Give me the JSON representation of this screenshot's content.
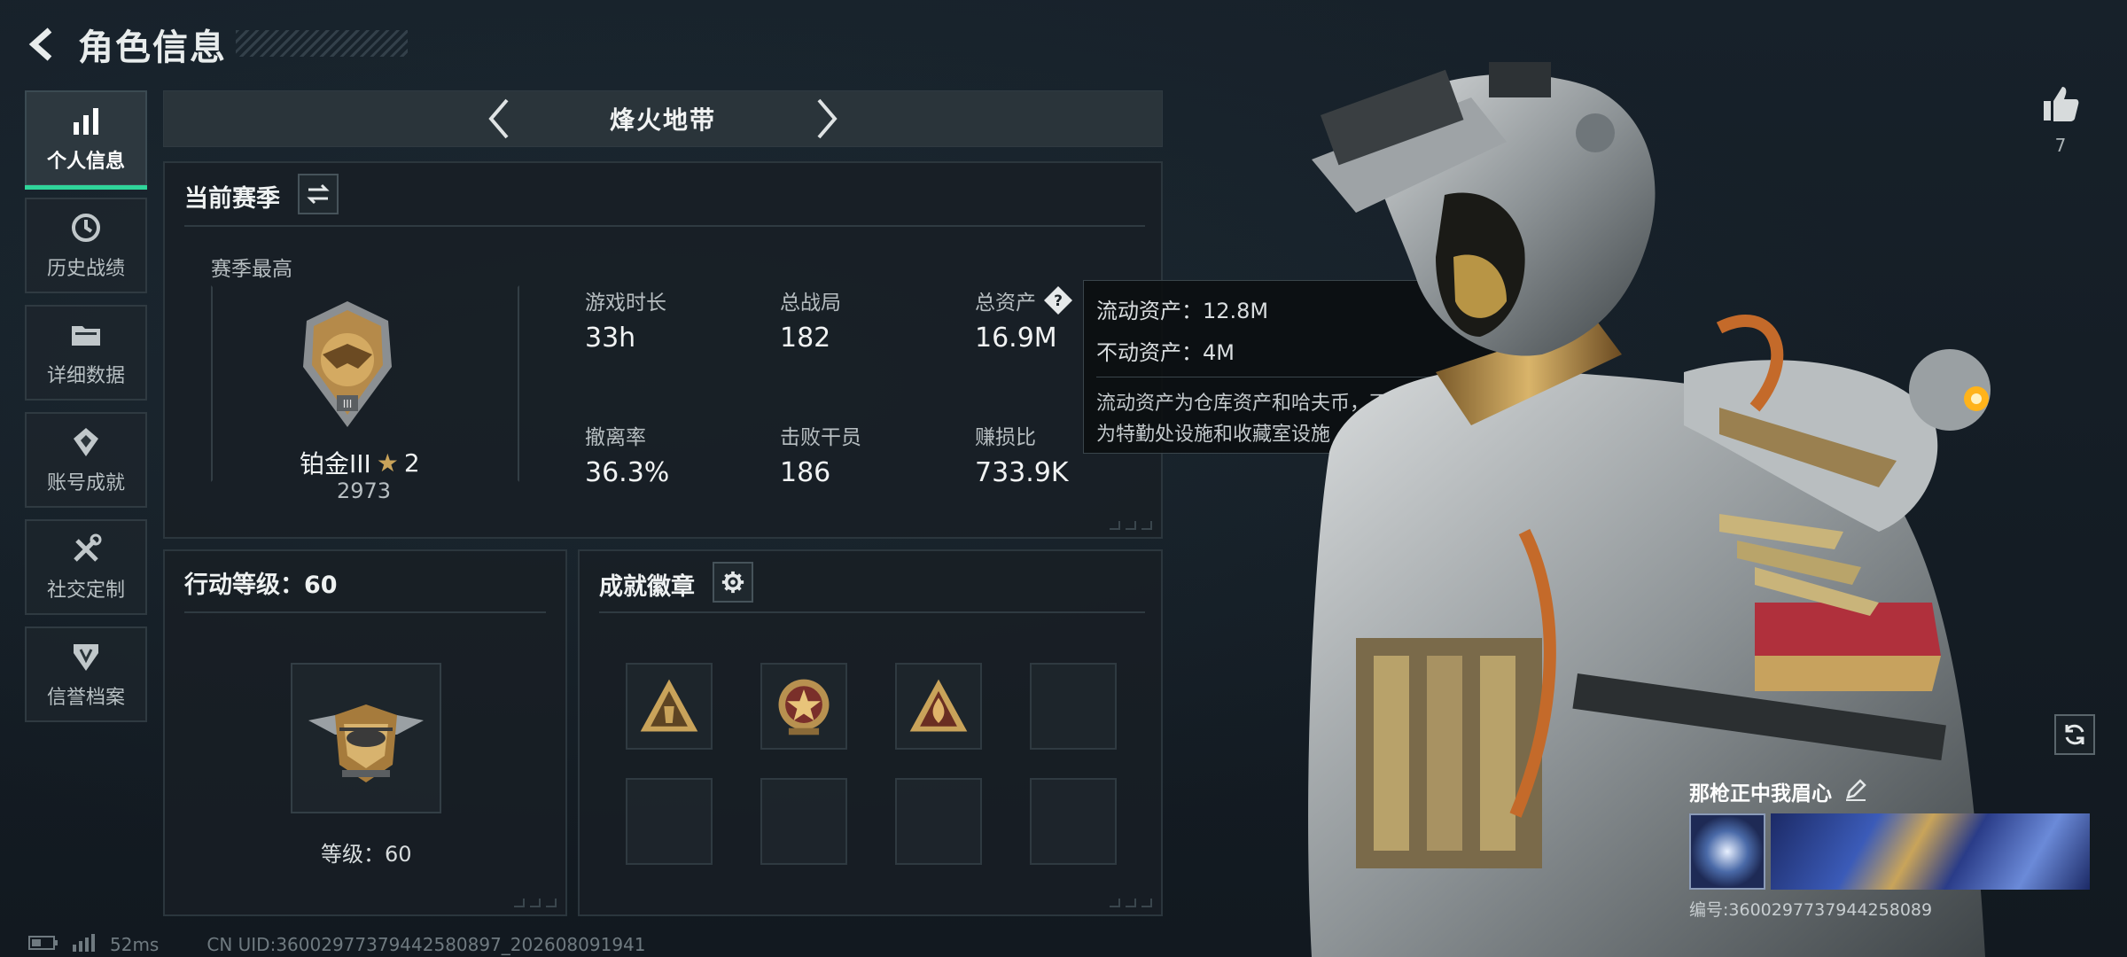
{
  "header": {
    "title": "角色信息"
  },
  "nav": {
    "items": [
      {
        "label": "个人信息",
        "icon": "bar-chart-icon",
        "active": true
      },
      {
        "label": "历史战绩",
        "icon": "history-clock-icon",
        "active": false
      },
      {
        "label": "详细数据",
        "icon": "folder-icon",
        "active": false
      },
      {
        "label": "账号成就",
        "icon": "achievement-icon",
        "active": false
      },
      {
        "label": "社交定制",
        "icon": "tools-icon",
        "active": false
      },
      {
        "label": "信誉档案",
        "icon": "shield-icon",
        "active": false
      }
    ]
  },
  "mode": {
    "title": "烽火地带"
  },
  "season": {
    "title": "当前赛季",
    "best_label": "赛季最高",
    "rank_name": "铂金III",
    "rank_stars": "2",
    "rank_score": "2973",
    "stats": [
      {
        "label": "游戏时长",
        "value": "33h"
      },
      {
        "label": "总战局",
        "value": "182"
      },
      {
        "label": "总资产",
        "value": "16.9M"
      },
      {
        "label": "撤离率",
        "value": "36.3%"
      },
      {
        "label": "击败干员",
        "value": "186"
      },
      {
        "label": "赚损比",
        "value": "733.9K"
      }
    ]
  },
  "tooltip": {
    "liquid": "流动资产：12.8M",
    "fixed": "不动资产：4M",
    "note_line1": "流动资产为仓库资产和哈夫币，不动资产",
    "note_line2": "为特勤处设施和收藏室设施"
  },
  "action_level": {
    "title": "行动等级：60",
    "level_label": "等级：60"
  },
  "badges": {
    "title": "成就徽章"
  },
  "likes": {
    "count": "7"
  },
  "player": {
    "name": "那枪正中我眉心",
    "id_text": "编号:3600297737944258089"
  },
  "footer": {
    "ping": "52ms",
    "uid": "CN UID:3600297737944258089​7_202608091941"
  },
  "colors": {
    "accent": "#2fd59a",
    "gold": "#c9a35a"
  }
}
